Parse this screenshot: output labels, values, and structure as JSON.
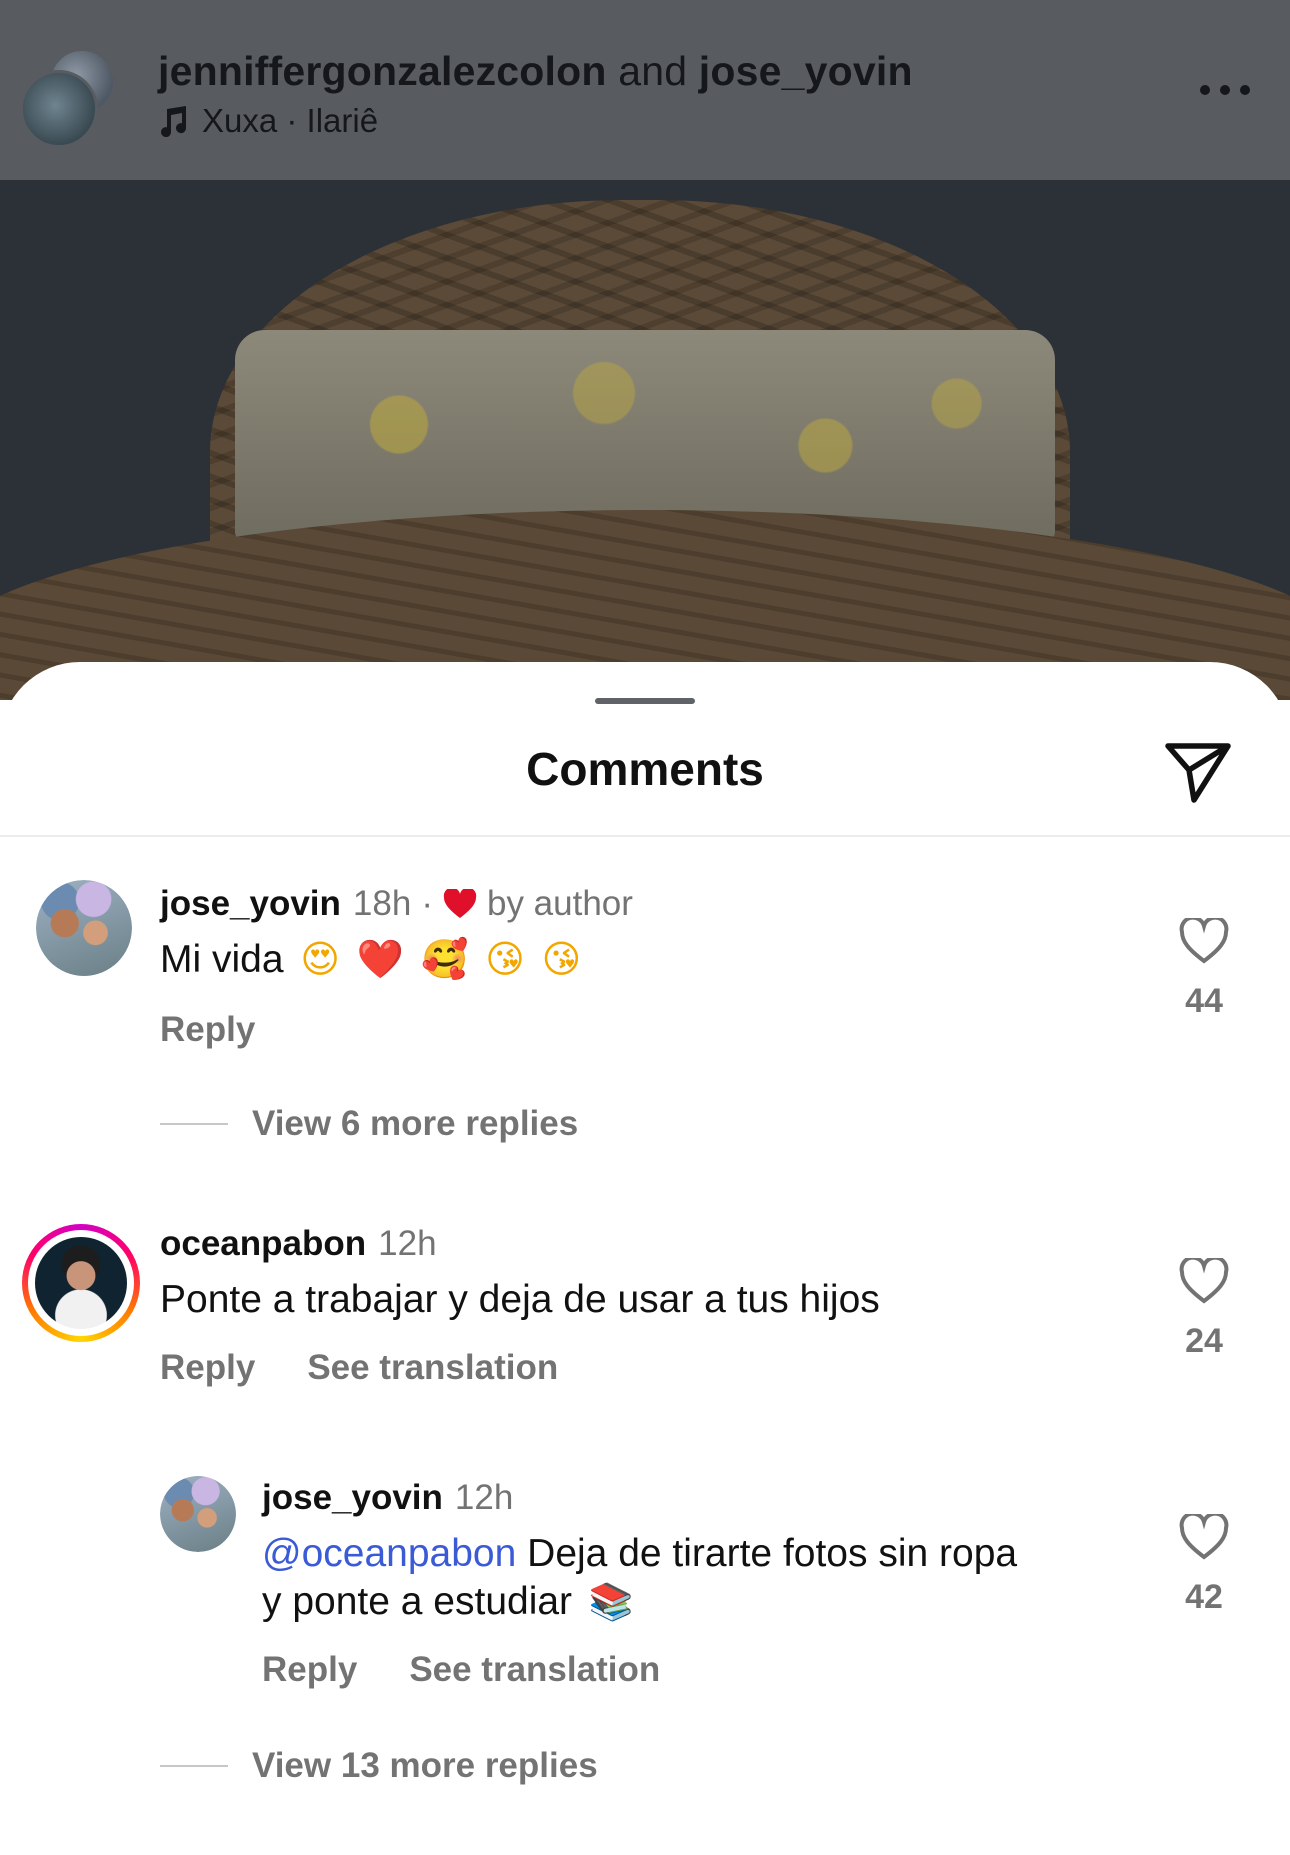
{
  "header": {
    "user1": "jenniffergonzalezcolon",
    "and_text": "and",
    "user2": "jose_yovin",
    "music": "Xuxa · Ilariê"
  },
  "sheet": {
    "title": "Comments"
  },
  "comments": [
    {
      "username": "jose_yovin",
      "time": "18h",
      "dot": "·",
      "liked_by": "by author",
      "text": "Mi vida",
      "emojis": [
        "😍",
        "❤️",
        "🥰",
        "😘",
        "😘"
      ],
      "reply": "Reply",
      "likes": "44",
      "view_replies": "View 6 more replies"
    },
    {
      "username": "oceanpabon",
      "time": "12h",
      "text": "Ponte a trabajar y deja de usar a tus hijos",
      "reply": "Reply",
      "see_translation": "See translation",
      "likes": "24"
    },
    {
      "username": "jose_yovin",
      "time": "12h",
      "mention": "@oceanpabon",
      "text_line1": "Deja de tirarte fotos sin ropa",
      "text_line2": "y ponte a estudiar",
      "emoji": "📚",
      "reply": "Reply",
      "see_translation": "See translation",
      "likes": "42",
      "view_replies": "View 13 more replies"
    }
  ],
  "colors": {
    "header_bg": "#585b60",
    "mention": "#3b5bd6",
    "secondary_text": "#737373",
    "heart_red": "#e0102a"
  },
  "icons": [
    "music-note-icon",
    "more-options-icon",
    "share-send-icon",
    "heart-outline-icon",
    "heart-filled-icon"
  ]
}
